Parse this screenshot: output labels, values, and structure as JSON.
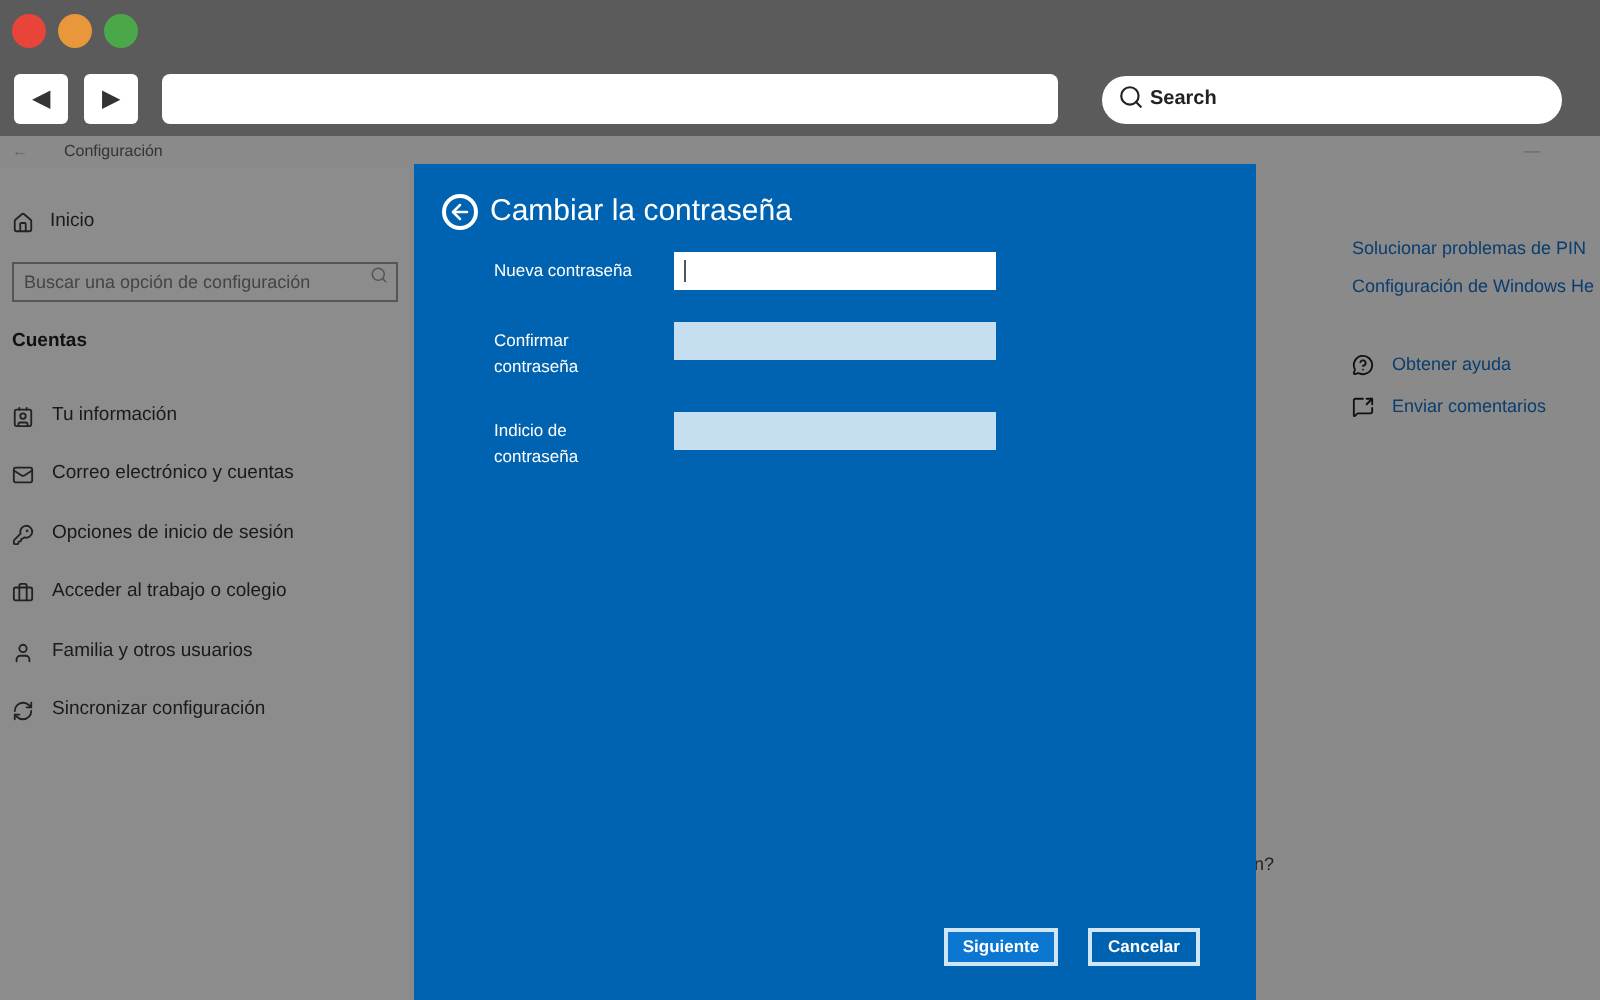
{
  "browser": {
    "back_button": "◀",
    "forward_button": "▶",
    "search": {
      "placeholder": "Search"
    }
  },
  "window": {
    "back": "←",
    "title": "Configuración",
    "minimize": "—"
  },
  "sidebar": {
    "home": "Inicio",
    "search": {
      "placeholder": "Buscar una opción de configuración"
    },
    "section": "Cuentas",
    "items": [
      {
        "label": "Tu información"
      },
      {
        "label": "Correo electrónico y cuentas"
      },
      {
        "label": "Opciones de inicio de sesión"
      },
      {
        "label": "Acceder al trabajo o colegio"
      },
      {
        "label": "Familia y otros usuarios"
      },
      {
        "label": "Sincronizar configuración"
      }
    ]
  },
  "related_links": [
    "Solucionar problemas de PIN",
    "Configuración de Windows He"
  ],
  "help_links": [
    "Obtener ayuda",
    "Enviar comentarios"
  ],
  "partial_text": "n?",
  "dialog": {
    "title": "Cambiar la contraseña",
    "fields": [
      {
        "label": "Nueva contraseña",
        "focused": true
      },
      {
        "label": "Confirmar contraseña",
        "focused": false
      },
      {
        "label": "Indicio de contraseña",
        "focused": false
      }
    ],
    "buttons": [
      {
        "label": "Siguiente",
        "primary": true
      },
      {
        "label": "Cancelar",
        "primary": false
      }
    ]
  }
}
